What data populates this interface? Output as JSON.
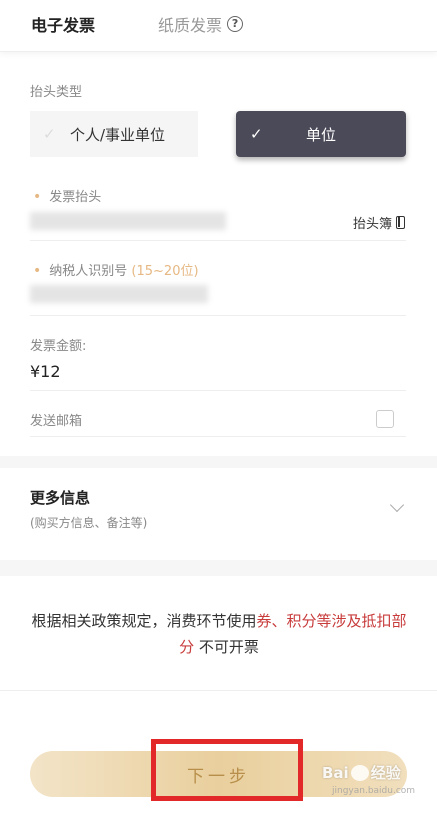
{
  "tabs": {
    "electronic": "电子发票",
    "paper": "纸质发票"
  },
  "title_type": {
    "label": "抬头类型",
    "options": [
      "个人/事业单位",
      "单位"
    ],
    "selected": "单位"
  },
  "invoice_title": {
    "label": "发票抬头",
    "book_link": "抬头簿"
  },
  "tax_id": {
    "label": "纳税人识别号",
    "hint": "(15~20位)"
  },
  "amount": {
    "label": "发票金额:",
    "value": "¥12"
  },
  "email": {
    "label": "发送邮箱"
  },
  "more_info": {
    "title": "更多信息",
    "subtitle": "(购买方信息、备注等)"
  },
  "policy": {
    "part1": "根据相关政策规定，消费环节使用",
    "part2": "券、积分等涉及抵扣部分",
    "part3": "不可开票"
  },
  "next_button": "下一步",
  "watermark": {
    "brand1": "Bai",
    "brand2": "经验",
    "sub": "jingyan.baidu.com"
  },
  "colors": {
    "accent_gold": "#e6b883",
    "selected_dark": "#4b4a58",
    "policy_red": "#c83c3c",
    "highlight_red": "#e22828"
  }
}
